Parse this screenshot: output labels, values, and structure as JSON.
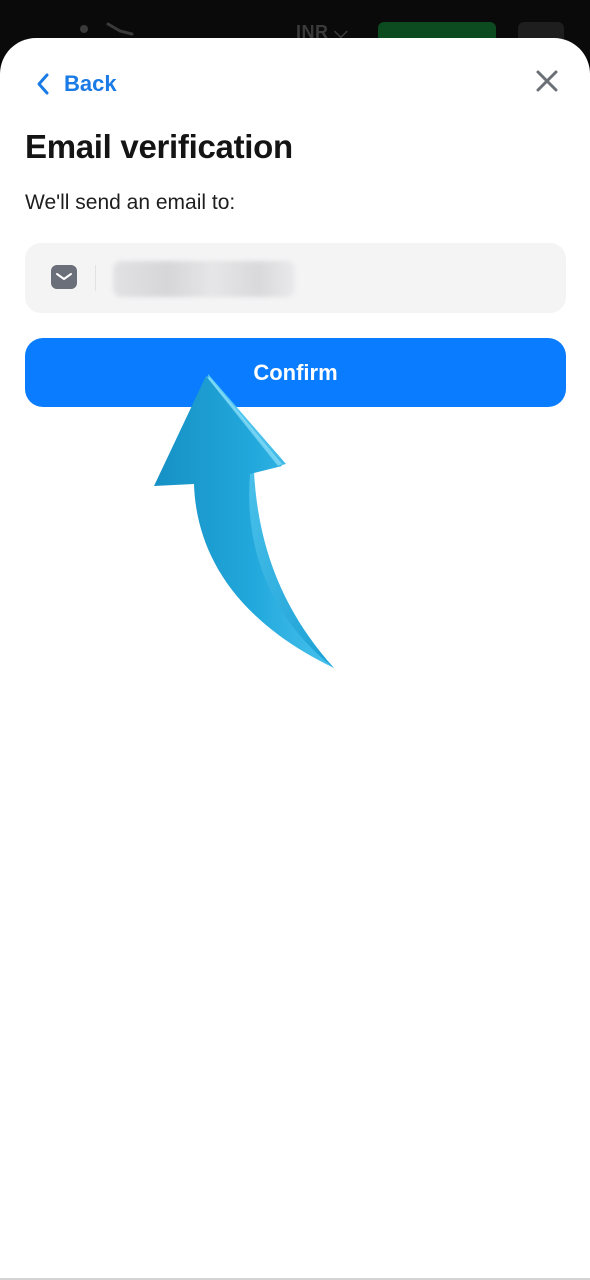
{
  "backdrop": {
    "currency": "INR"
  },
  "header": {
    "back_label": "Back",
    "back_icon": "chevron-left-icon",
    "close_icon": "close-icon"
  },
  "main": {
    "title": "Email verification",
    "subtitle": "We'll send an email to:",
    "email_field": {
      "icon": "mail-icon",
      "value": "••••••••••••••"
    },
    "confirm_label": "Confirm"
  },
  "colors": {
    "accent": "#0a7cff",
    "link": "#1a7ae6",
    "field_bg": "#f4f4f5",
    "arrow": "#1fa3d6"
  },
  "overlay": {
    "icon": "curved-arrow-up-icon"
  }
}
